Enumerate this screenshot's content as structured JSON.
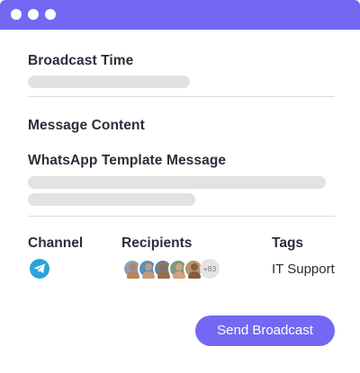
{
  "form": {
    "broadcast_time_label": "Broadcast Time",
    "message_content_label": "Message Content",
    "whatsapp_template_label": "WhatsApp Template Message"
  },
  "columns": {
    "channel_label": "Channel",
    "recipients_label": "Recipients",
    "tags_label": "Tags"
  },
  "channel": {
    "icon": "telegram-icon"
  },
  "recipients": {
    "avatars": [
      {
        "name": "avatar-1",
        "tone": "#b7835f",
        "bg": "#8ca0b5"
      },
      {
        "name": "avatar-2",
        "tone": "#c89a7a",
        "bg": "#5d8fb8"
      },
      {
        "name": "avatar-3",
        "tone": "#9a6c4f",
        "bg": "#6f7f8c"
      },
      {
        "name": "avatar-4",
        "tone": "#d0a27f",
        "bg": "#7d9a7a"
      },
      {
        "name": "avatar-5",
        "tone": "#8a5c3e",
        "bg": "#b59570"
      }
    ],
    "more_count": "+83"
  },
  "tags": {
    "value": "IT Support"
  },
  "actions": {
    "send_label": "Send Broadcast"
  },
  "colors": {
    "accent": "#7468f2",
    "telegram": "#2aa3dd",
    "placeholder_bar": "#e2e2e4"
  }
}
